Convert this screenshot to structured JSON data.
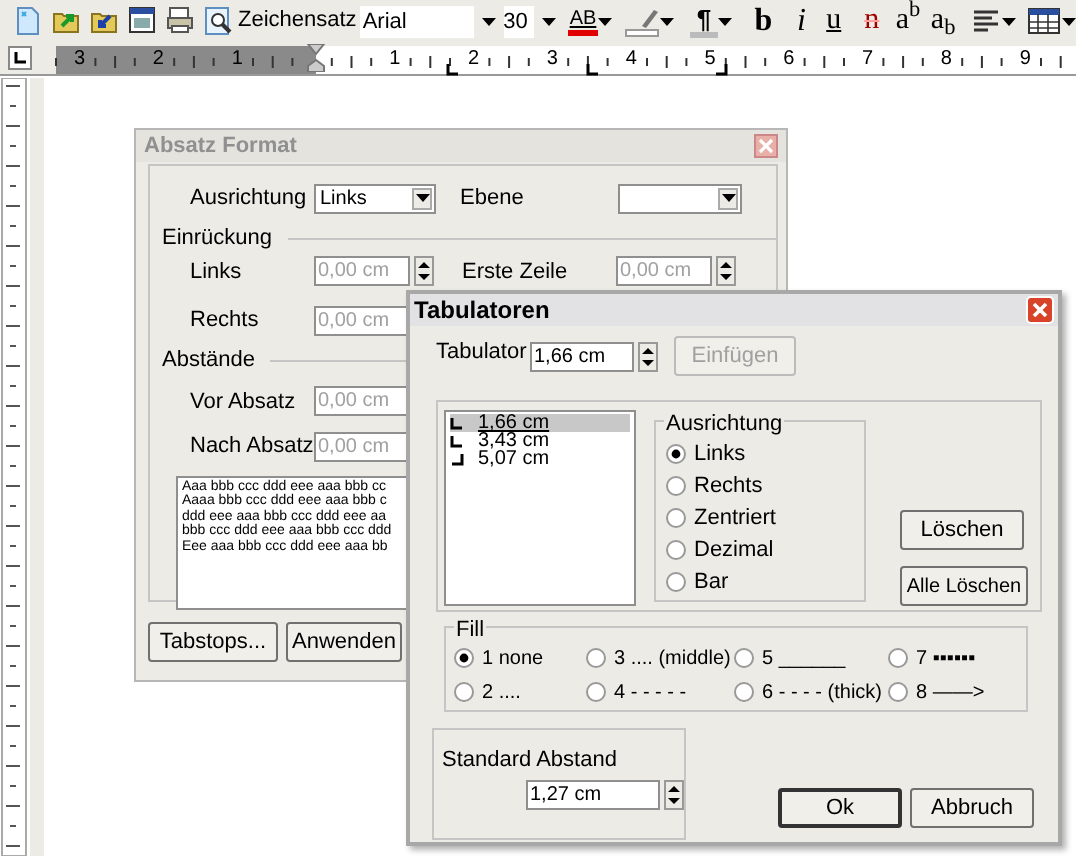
{
  "toolbar": {
    "font_label": "Zeichensatz",
    "font": "Arial",
    "size": "30",
    "format_buttons": [
      {
        "kind": "color",
        "label": "AB"
      },
      {
        "kind": "highlight"
      },
      {
        "kind": "pilcrow",
        "label": "¶"
      },
      {
        "kind": "bold",
        "label": "b"
      },
      {
        "kind": "italic",
        "label": "i"
      },
      {
        "kind": "underline",
        "label": "u"
      },
      {
        "kind": "strike",
        "label": "n"
      },
      {
        "kind": "super",
        "label": "a$^{b}$"
      },
      {
        "kind": "sub",
        "label": "a$_{b}$"
      },
      {
        "kind": "align"
      },
      {
        "kind": "table"
      }
    ]
  },
  "ruler": {
    "labels": [
      "3",
      "2",
      "1",
      "1",
      "2",
      "3",
      "4",
      "5",
      "6",
      "7",
      "8",
      "9"
    ]
  },
  "absatz_dialog": {
    "title": "Absatz Format",
    "ausrichtung": {
      "label": "Ausrichtung",
      "value": "Links"
    },
    "ebene": {
      "label": "Ebene"
    },
    "einrueckung": {
      "heading": "Einrückung",
      "links": {
        "label": "Links",
        "value": "0,00 cm",
        "disabled": true
      },
      "rechts": {
        "label": "Rechts",
        "value": "0,00 cm",
        "disabled": true
      },
      "erste_zeile": {
        "label": "Erste Zeile",
        "value": "0,00 cm",
        "disabled": true
      }
    },
    "abstaende": {
      "heading": "Abstände",
      "vor_absatz": {
        "label": "Vor Absatz",
        "value": "0,00 cm",
        "disabled": true
      },
      "nach_absatz": {
        "label": "Nach Absatz",
        "value": "0,00 cm",
        "disabled": true
      }
    },
    "preview_lines": [
      "Aaa bbb ccc ddd eee aaa bbb cc",
      "Aaaa bbb ccc ddd eee aaa bbb c",
      "ddd eee aaa bbb ccc ddd eee aa",
      "bbb ccc ddd eee aaa bbb ccc ddd",
      "Eee aaa bbb ccc ddd eee aaa bb"
    ],
    "buttons": [
      "Tabstops...",
      "Anwenden"
    ]
  },
  "tab_dialog": {
    "title": "Tabulatoren",
    "tabulator": {
      "label": "Tabulator",
      "value": "1,66 cm"
    },
    "insert_button": {
      "label": "Einfügen",
      "disabled": true
    },
    "tab_list": [
      {
        "kind": "left",
        "label": "1,66 cm",
        "selected": true
      },
      {
        "kind": "left",
        "label": "3,43 cm",
        "selected": false
      },
      {
        "kind": "right",
        "label": "5,07 cm",
        "selected": false
      }
    ],
    "ausrichtung": {
      "heading": "Ausrichtung",
      "options": [
        {
          "label": "Links",
          "selected": true
        },
        {
          "label": "Rechts",
          "selected": false
        },
        {
          "label": "Zentriert",
          "selected": false
        },
        {
          "label": "Dezimal",
          "selected": false
        },
        {
          "label": "Bar",
          "selected": false
        }
      ]
    },
    "delete_button": "Löschen",
    "delete_all_button": "Alle Löschen",
    "fill": {
      "heading": "Fill",
      "options": [
        {
          "label": "1 none",
          "selected": true
        },
        {
          "label": "3 .... (middle)",
          "selected": false
        },
        {
          "label": "5 ______",
          "selected": false
        },
        {
          "label": "7 ▪▪▪▪▪▪",
          "selected": false
        },
        {
          "label": "2 ....",
          "selected": false
        },
        {
          "label": "4 - - - - -",
          "selected": false
        },
        {
          "label": "6 - - - - (thick)",
          "selected": false
        },
        {
          "label": "8 ——>",
          "selected": false
        }
      ]
    },
    "standard_abstand": {
      "label": "Standard Abstand",
      "value": "1,27 cm"
    },
    "ok_button": "Ok",
    "cancel_button": "Abbruch"
  }
}
